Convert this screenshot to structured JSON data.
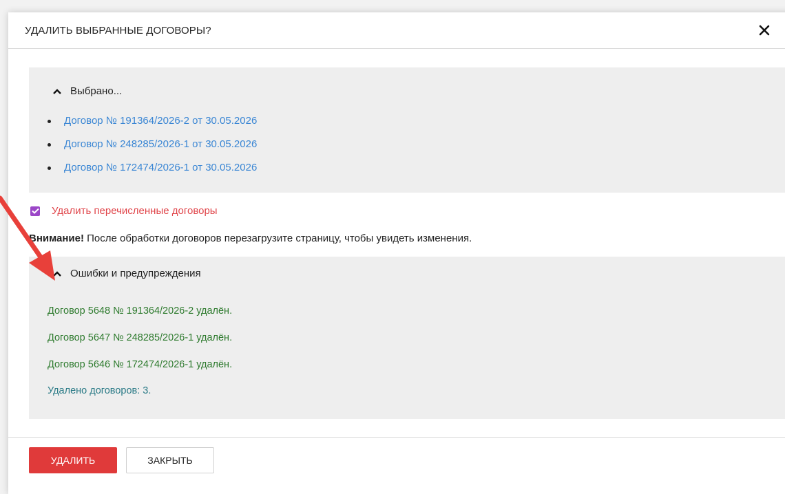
{
  "dialog": {
    "title": "УДАЛИТЬ ВЫБРАННЫЕ ДОГОВОРЫ?",
    "close_icon": "close-icon"
  },
  "selected_panel": {
    "toggle_label": "Выбрано...",
    "items": [
      "Договор № 191364/2026-2 от 30.05.2026",
      "Договор № 248285/2026-1 от 30.05.2026",
      "Договор № 172474/2026-1 от 30.05.2026"
    ]
  },
  "delete_checkbox": {
    "label": "Удалить перечисленные договоры",
    "checked": true,
    "color": "#9b47c7"
  },
  "warning": {
    "bold": "Внимание!",
    "text": " После обработки договоров перезагрузите страницу, чтобы увидеть изменения."
  },
  "errors_panel": {
    "toggle_label": "Ошибки и предупреждения",
    "messages": [
      "Договор 5648 № 191364/2026-2 удалён.",
      "Договор 5647 № 248285/2026-1 удалён.",
      "Договор 5646 № 172474/2026-1 удалён."
    ],
    "summary": "Удалено договоров: 3."
  },
  "footer": {
    "delete_label": "УДАЛИТЬ",
    "close_label": "ЗАКРЫТЬ"
  },
  "colors": {
    "link": "#3a86d4",
    "success": "#2d7a2d",
    "info": "#2a7a86",
    "danger": "#e03a3a",
    "arrow": "#e8403a"
  }
}
